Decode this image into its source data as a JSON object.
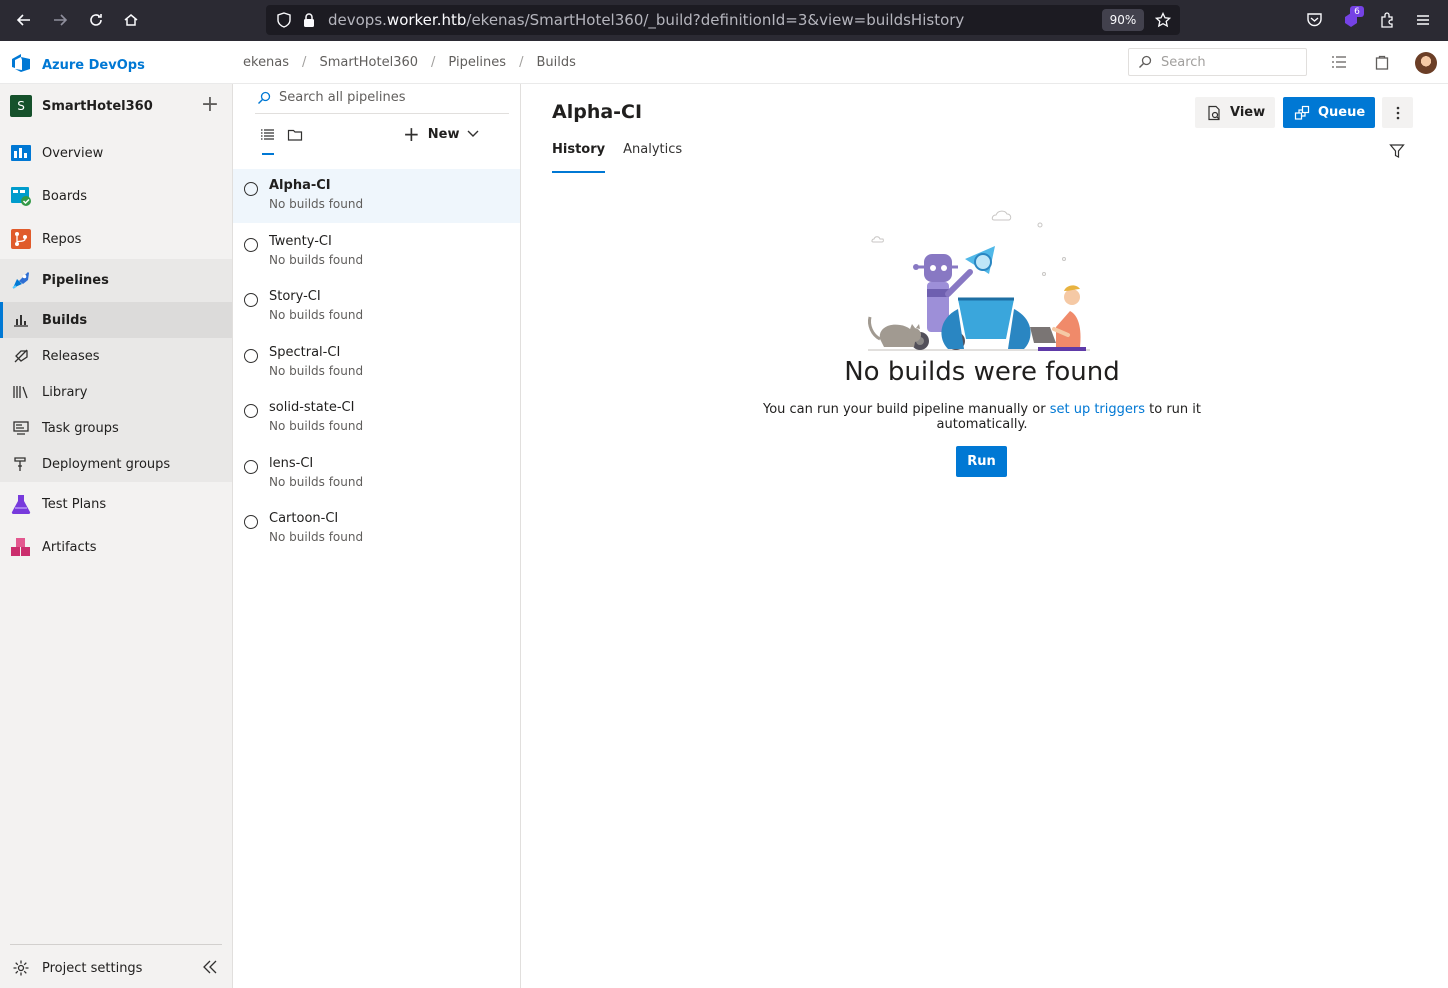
{
  "browser": {
    "url_prefix": "devops.",
    "url_host": "worker.htb",
    "url_path": "/ekenas/SmartHotel360/_build?definitionId=3&view=buildsHistory",
    "zoom": "90%",
    "extension_badge": "6"
  },
  "header": {
    "brand": "Azure DevOps",
    "breadcrumb": [
      "ekenas",
      "SmartHotel360",
      "Pipelines",
      "Builds"
    ],
    "search_placeholder": "Search"
  },
  "sidebar": {
    "project_initial": "S",
    "project_name": "SmartHotel360",
    "items": [
      {
        "label": "Overview"
      },
      {
        "label": "Boards"
      },
      {
        "label": "Repos"
      },
      {
        "label": "Pipelines"
      },
      {
        "label": "Builds"
      },
      {
        "label": "Releases"
      },
      {
        "label": "Library"
      },
      {
        "label": "Task groups"
      },
      {
        "label": "Deployment groups"
      },
      {
        "label": "Test Plans"
      },
      {
        "label": "Artifacts"
      }
    ],
    "settings_label": "Project settings"
  },
  "pipelines_list": {
    "search_placeholder": "Search all pipelines",
    "new_label": "New",
    "items": [
      {
        "name": "Alpha-CI",
        "status": "No builds found"
      },
      {
        "name": "Twenty-CI",
        "status": "No builds found"
      },
      {
        "name": "Story-CI",
        "status": "No builds found"
      },
      {
        "name": "Spectral-CI",
        "status": "No builds found"
      },
      {
        "name": "solid-state-CI",
        "status": "No builds found"
      },
      {
        "name": "lens-CI",
        "status": "No builds found"
      },
      {
        "name": "Cartoon-CI",
        "status": "No builds found"
      }
    ]
  },
  "main": {
    "title": "Alpha-CI",
    "view_label": "View",
    "queue_label": "Queue",
    "tabs": [
      {
        "label": "History"
      },
      {
        "label": "Analytics"
      }
    ],
    "empty_title": "No builds were found",
    "empty_desc_before": "You can run your build pipeline manually or ",
    "empty_desc_link": "set up triggers",
    "empty_desc_after": " to run it automatically.",
    "run_label": "Run"
  },
  "colors": {
    "accent": "#0078d4",
    "browser_bg": "#2b2a33",
    "sidebar_bg": "#f3f2f1"
  }
}
